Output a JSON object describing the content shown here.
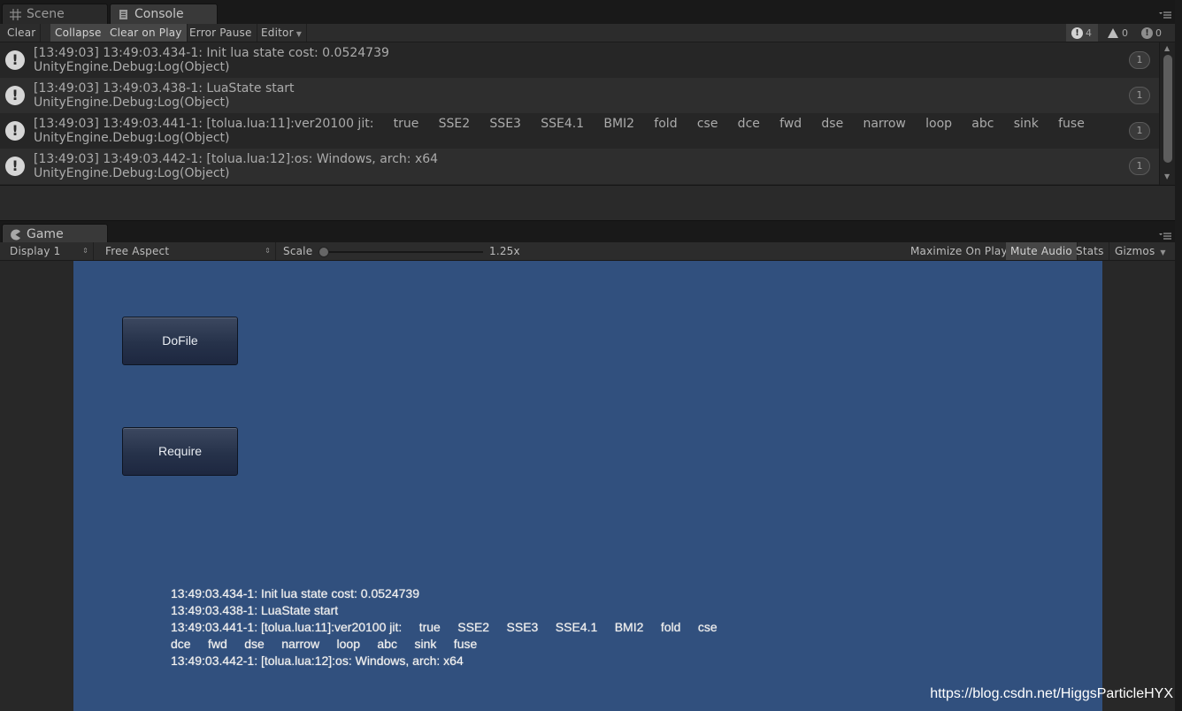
{
  "top_tabs": [
    {
      "label": "Scene",
      "icon": "grid-icon"
    },
    {
      "label": "Console",
      "icon": "console-icon"
    }
  ],
  "console_toolbar": {
    "clear": "Clear",
    "collapse": "Collapse",
    "clear_on_play": "Clear on Play",
    "error_pause": "Error Pause",
    "editor": "Editor",
    "info_count": "4",
    "warning_count": "0",
    "error_count": "0"
  },
  "logs": [
    {
      "line1": "[13:49:03] 13:49:03.434-1: Init lua state cost: 0.0524739",
      "line2": "UnityEngine.Debug:Log(Object)",
      "count": "1"
    },
    {
      "line1": "[13:49:03] 13:49:03.438-1: LuaState start",
      "line2": "UnityEngine.Debug:Log(Object)",
      "count": "1"
    },
    {
      "line1": "[13:49:03] 13:49:03.441-1: [tolua.lua:11]:ver20100 jit:     true     SSE2     SSE3     SSE4.1     BMI2     fold     cse     dce     fwd     dse     narrow     loop     abc     sink     fuse",
      "line2": "UnityEngine.Debug:Log(Object)",
      "count": "1"
    },
    {
      "line1": "[13:49:03] 13:49:03.442-1: [tolua.lua:12]:os: Windows, arch: x64",
      "line2": "UnityEngine.Debug:Log(Object)",
      "count": "1"
    }
  ],
  "game_tab": {
    "label": "Game",
    "icon": "pacman-icon"
  },
  "game_toolbar": {
    "display": "Display 1",
    "aspect": "Free Aspect",
    "scale_label": "Scale",
    "scale_value": "1.25x",
    "maximize_on_play": "Maximize On Play",
    "mute_audio": "Mute Audio",
    "stats": "Stats",
    "gizmos": "Gizmos"
  },
  "game": {
    "dofile_button": "DoFile",
    "require_button": "Require",
    "log_lines": [
      "13:49:03.434-1: Init lua state cost: 0.0524739",
      "13:49:03.438-1: LuaState start",
      "13:49:03.441-1: [tolua.lua:11]:ver20100 jit:     true     SSE2     SSE3     SSE4.1     BMI2     fold     cse",
      "dce     fwd     dse     narrow     loop     abc     sink     fuse",
      "13:49:03.442-1: [tolua.lua:12]:os: Windows, arch: x64"
    ]
  },
  "watermark": "https://blog.csdn.net/HiggsParticleHYX",
  "colors": {
    "game_background": "#31507e",
    "editor_background": "#282828"
  }
}
